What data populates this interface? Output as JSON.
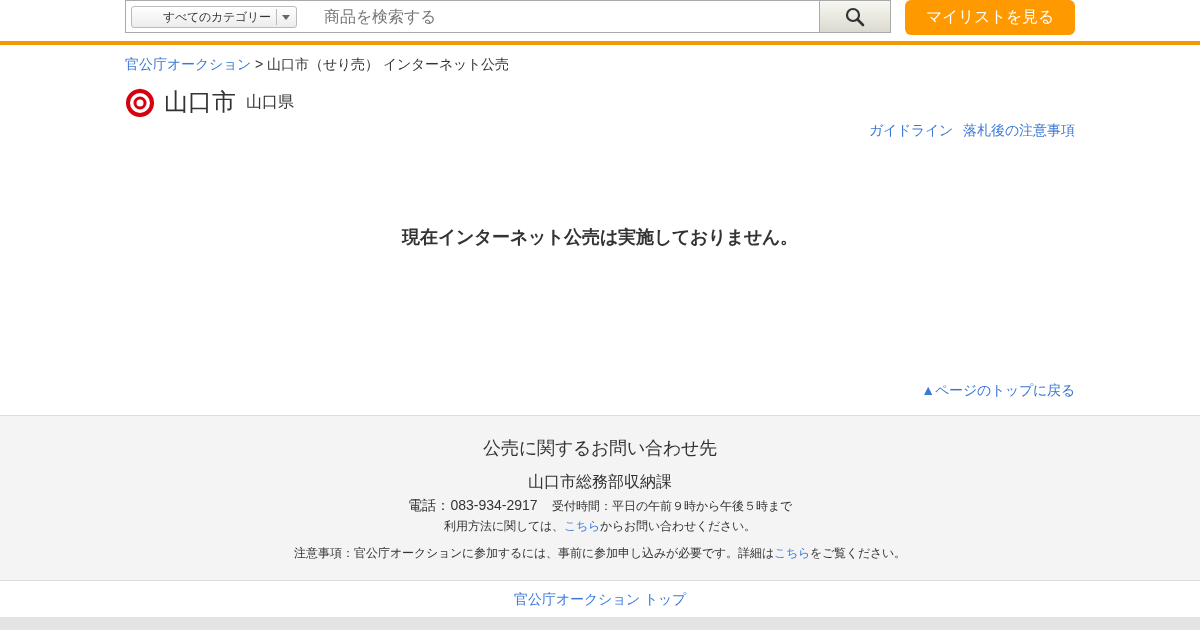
{
  "header": {
    "category": "すべてのカテゴリー",
    "search_placeholder": "商品を検索する",
    "mylist_button": "マイリストを見る"
  },
  "breadcrumb": {
    "link": "官公庁オークション",
    "separator": ">",
    "current": "山口市（せり売） インターネット公売"
  },
  "title": {
    "name": "山口市",
    "prefecture": "山口県"
  },
  "links": [
    "ガイドライン",
    "落札後の注意事項"
  ],
  "message": "現在インターネット公売は実施しておりません。",
  "back_to_top": "▲ページのトップに戻る",
  "contact": {
    "heading": "公売に関するお問い合わせ先",
    "department": "山口市総務部収納課",
    "phone": "電話：083-934-2917",
    "hours": "受付時間：平日の午前９時から午後５時まで",
    "usage": {
      "before": "利用方法に関しては、",
      "link": "こちら",
      "after": "からお問い合わせください。"
    },
    "notice": {
      "before": "注意事項：官公庁オークションに参加するには、事前に参加申し込みが必要です。詳細は",
      "link": "こちら",
      "after": "をご覧ください。"
    }
  },
  "footer_link": "官公庁オークション トップ"
}
